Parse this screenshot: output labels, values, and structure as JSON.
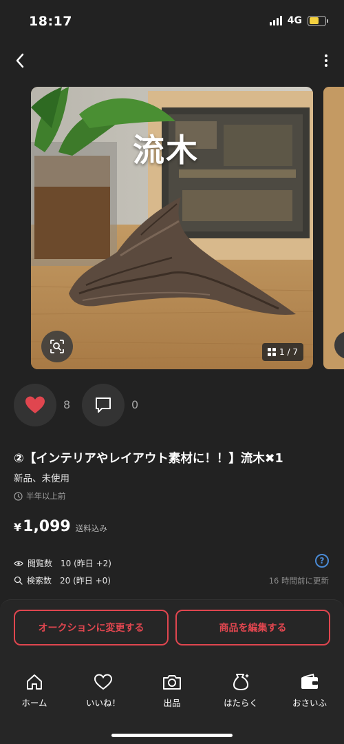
{
  "status_bar": {
    "time": "18:17",
    "network": "4G"
  },
  "gallery": {
    "caption": "流木",
    "counter": "1 / 7"
  },
  "reactions": {
    "likes": "8",
    "comments": "0"
  },
  "product": {
    "title": "②【インテリアやレイアウト素材に！！】流木✖︎1",
    "condition": "新品、未使用",
    "posted": "半年以上前",
    "price_currency": "¥",
    "price_value": "1,099",
    "shipping": "送料込み"
  },
  "stats": {
    "views_label": "閲覧数",
    "views_value": "10 (昨日 +2)",
    "search_label": "検索数",
    "search_value": "20 (昨日 +0)",
    "help": "?",
    "updated": "16 時間前に更新"
  },
  "actions": {
    "auction": "オークションに変更する",
    "edit": "商品を編集する"
  },
  "tabs": [
    {
      "label": "ホーム",
      "icon": "home-icon"
    },
    {
      "label": "いいね！",
      "icon": "heart-icon"
    },
    {
      "label": "出品",
      "icon": "camera-icon"
    },
    {
      "label": "はたらく",
      "icon": "money-bag-icon"
    },
    {
      "label": "おさいふ",
      "icon": "wallet-icon"
    }
  ],
  "colors": {
    "background": "#222222",
    "accent": "#e0464f",
    "link": "#4a8bd6"
  }
}
